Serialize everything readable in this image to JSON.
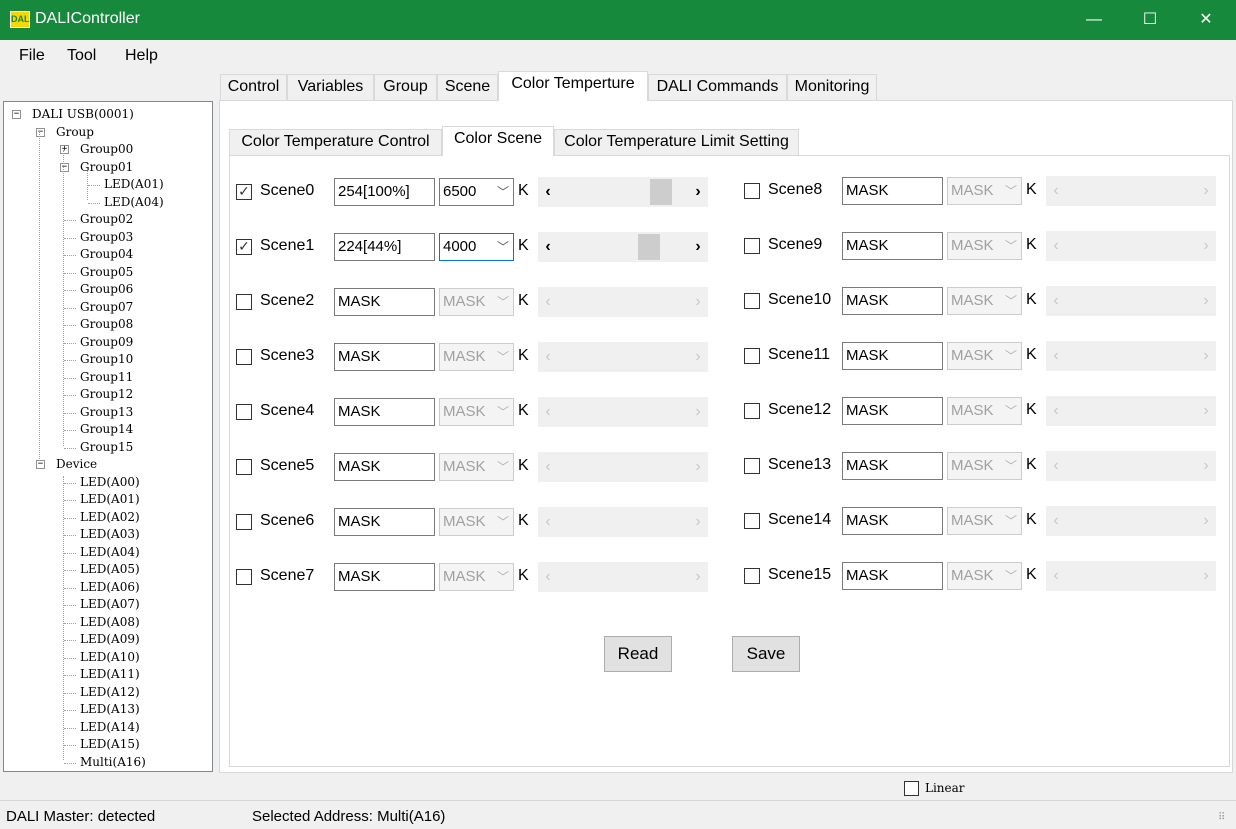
{
  "window": {
    "title": "DALIController",
    "icon_text": "DALI",
    "minimize": "—",
    "maximize": "☐",
    "close": "✕"
  },
  "menu": [
    "File",
    "Tool",
    "Help"
  ],
  "tree": {
    "root": "DALI USB(0001)",
    "group_node": "Group",
    "groups": [
      "Group00",
      "Group01",
      "Group02",
      "Group03",
      "Group04",
      "Group05",
      "Group06",
      "Group07",
      "Group08",
      "Group09",
      "Group10",
      "Group11",
      "Group12",
      "Group13",
      "Group14",
      "Group15"
    ],
    "group01_children": [
      "LED(A01)",
      "LED(A04)"
    ],
    "device_node": "Device",
    "devices": [
      "LED(A00)",
      "LED(A01)",
      "LED(A02)",
      "LED(A03)",
      "LED(A04)",
      "LED(A05)",
      "LED(A06)",
      "LED(A07)",
      "LED(A08)",
      "LED(A09)",
      "LED(A10)",
      "LED(A11)",
      "LED(A12)",
      "LED(A13)",
      "LED(A14)",
      "LED(A15)",
      "Multi(A16)"
    ]
  },
  "main_tabs": [
    "Control",
    "Variables",
    "Group",
    "Scene",
    "Color Temperture",
    "DALI Commands",
    "Monitoring"
  ],
  "main_active_tab": "Color Temperture",
  "sub_tabs": [
    "Color Temperature Control",
    "Color Scene",
    "Color Temperature Limit Setting"
  ],
  "sub_active_tab": "Color Scene",
  "k_label": "K",
  "scenes_left": [
    {
      "name": "Scene0",
      "checked": true,
      "level": "254[100%]",
      "temp": "6500",
      "enabled": true,
      "slider": 0.85
    },
    {
      "name": "Scene1",
      "checked": true,
      "level": "224[44%]",
      "temp": "4000",
      "enabled": true,
      "slider": 0.74
    },
    {
      "name": "Scene2",
      "checked": false,
      "level": "MASK",
      "temp": "MASK",
      "enabled": false
    },
    {
      "name": "Scene3",
      "checked": false,
      "level": "MASK",
      "temp": "MASK",
      "enabled": false
    },
    {
      "name": "Scene4",
      "checked": false,
      "level": "MASK",
      "temp": "MASK",
      "enabled": false
    },
    {
      "name": "Scene5",
      "checked": false,
      "level": "MASK",
      "temp": "MASK",
      "enabled": false
    },
    {
      "name": "Scene6",
      "checked": false,
      "level": "MASK",
      "temp": "MASK",
      "enabled": false
    },
    {
      "name": "Scene7",
      "checked": false,
      "level": "MASK",
      "temp": "MASK",
      "enabled": false
    }
  ],
  "scenes_right": [
    {
      "name": "Scene8",
      "checked": false,
      "level": "MASK",
      "temp": "MASK",
      "enabled": false
    },
    {
      "name": "Scene9",
      "checked": false,
      "level": "MASK",
      "temp": "MASK",
      "enabled": false
    },
    {
      "name": "Scene10",
      "checked": false,
      "level": "MASK",
      "temp": "MASK",
      "enabled": false
    },
    {
      "name": "Scene11",
      "checked": false,
      "level": "MASK",
      "temp": "MASK",
      "enabled": false
    },
    {
      "name": "Scene12",
      "checked": false,
      "level": "MASK",
      "temp": "MASK",
      "enabled": false
    },
    {
      "name": "Scene13",
      "checked": false,
      "level": "MASK",
      "temp": "MASK",
      "enabled": false
    },
    {
      "name": "Scene14",
      "checked": false,
      "level": "MASK",
      "temp": "MASK",
      "enabled": false
    },
    {
      "name": "Scene15",
      "checked": false,
      "level": "MASK",
      "temp": "MASK",
      "enabled": false
    }
  ],
  "buttons": {
    "read": "Read",
    "save": "Save"
  },
  "linear_label": "Linear",
  "status": {
    "master": "DALI Master: detected",
    "address": "Selected Address: Multi(A16)"
  },
  "colors": {
    "titlebar": "#17893c",
    "focus": "#0078d7"
  }
}
